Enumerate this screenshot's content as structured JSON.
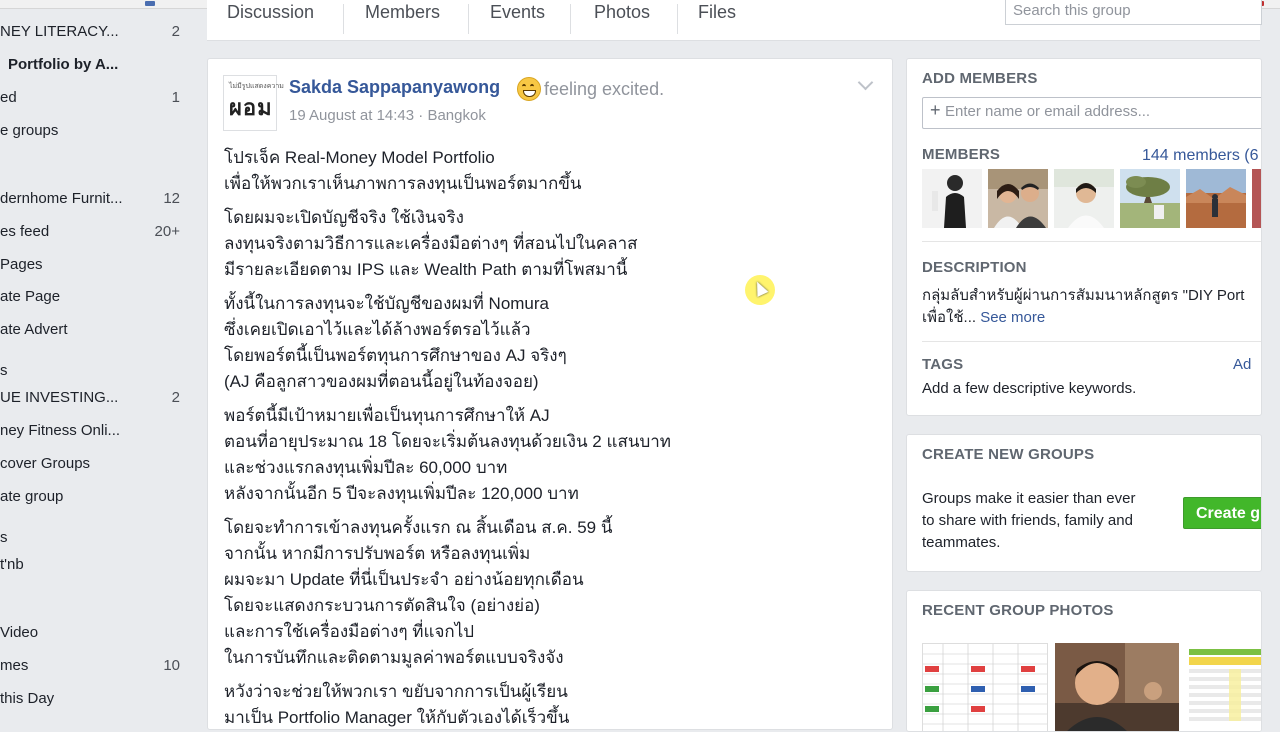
{
  "sidebar": {
    "items": [
      {
        "label": "NEY LITERACY...",
        "count": "2",
        "bold": false
      },
      {
        "label": "Portfolio by A...",
        "count": "",
        "bold": true
      },
      {
        "label": "ed",
        "count": "1",
        "bold": false
      },
      {
        "label": "e groups",
        "count": "",
        "bold": false
      },
      {
        "label": "dernhome Furnit...",
        "count": "12",
        "bold": false
      },
      {
        "label": "es feed",
        "count": "20+",
        "bold": false
      },
      {
        "label": "Pages",
        "count": "",
        "bold": false
      },
      {
        "label": "ate Page",
        "count": "",
        "bold": false
      },
      {
        "label": "ate Advert",
        "count": "",
        "bold": false
      },
      {
        "label": "s",
        "count": "",
        "bold": false
      },
      {
        "label": "UE INVESTING...",
        "count": "2",
        "bold": false
      },
      {
        "label": "ney Fitness Onli...",
        "count": "",
        "bold": false
      },
      {
        "label": "cover Groups",
        "count": "",
        "bold": false
      },
      {
        "label": "ate group",
        "count": "",
        "bold": false
      },
      {
        "label": "s",
        "count": "",
        "bold": false
      },
      {
        "label": "t'nb",
        "count": "",
        "bold": false
      },
      {
        "label": "Video",
        "count": "",
        "bold": false
      },
      {
        "label": "mes",
        "count": "10",
        "bold": false
      },
      {
        "label": "this Day",
        "count": "",
        "bold": false
      }
    ]
  },
  "tabs": {
    "discussion": "Discussion",
    "members": "Members",
    "events": "Events",
    "photos": "Photos",
    "files": "Files",
    "search_placeholder": "Search this group"
  },
  "post": {
    "avatar_small": "ไม่มีรูปแสดงความ",
    "avatar_main": "ผอม",
    "author": "Sakda Sappapanyawong",
    "feeling": "feeling excited.",
    "date": "19 August at 14:43",
    "location": "Bangkok",
    "meta_separator": "·",
    "paragraphs": [
      [
        "โปรเจ็ค Real-Money Model Portfolio",
        "เพื่อให้พวกเราเห็นภาพการลงทุนเป็นพอร์ตมากขึ้น"
      ],
      [
        "โดยผมจะเปิดบัญชีจริง ใช้เงินจริง",
        "ลงทุนจริงตามวิธีการและเครื่องมือต่างๆ ที่สอนไปในคลาส",
        "มีรายละเอียดตาม IPS และ Wealth Path ตามที่โพสมานี้"
      ],
      [
        "ทั้งนี้ในการลงทุนจะใช้บัญชีของผมที่ Nomura",
        "ซึ่งเคยเปิดเอาไว้และได้ล้างพอร์ตรอไว้แล้ว",
        "โดยพอร์ตนี้เป็นพอร์ตทุนการศึกษาของ AJ จริงๆ",
        "(AJ คือลูกสาวของผมที่ตอนนี้อยู่ในท้องจอย)"
      ],
      [
        "พอร์ตนี้มีเป้าหมายเพื่อเป็นทุนการศึกษาให้ AJ",
        "ตอนที่อายุประมาณ 18 โดยจะเริ่มต้นลงทุนด้วยเงิน 2 แสนบาท",
        "และช่วงแรกลงทุนเพิ่มปีละ 60,000 บาท",
        "หลังจากนั้นอีก 5 ปีจะลงทุนเพิ่มปีละ 120,000 บาท"
      ],
      [
        "โดยจะทำการเข้าลงทุนครั้งแรก ณ สิ้นเดือน ส.ค. 59 นี้",
        "จากนั้น หากมีการปรับพอร์ต หรือลงทุนเพิ่ม",
        "ผมจะมา Update ที่นี่เป็นประจำ อย่างน้อยทุกเดือน",
        "โดยจะแสดงกระบวนการตัดสินใจ (อย่างย่อ)",
        "และการใช้เครื่องมือต่างๆ ที่แจกไป",
        "ในการบันทึกและติดตามมูลค่าพอร์ตแบบจริงจัง"
      ],
      [
        "หวังว่าจะช่วยให้พวกเรา ขยับจากการเป็นผู้เรียน",
        "มาเป็น Portfolio Manager ให้กับตัวเองได้เร็วขึ้น"
      ]
    ]
  },
  "right": {
    "add_members": {
      "title": "ADD MEMBERS",
      "placeholder": "Enter name or email address..."
    },
    "members": {
      "title": "MEMBERS",
      "count_link": "144 members (6"
    },
    "description": {
      "title": "DESCRIPTION",
      "line1": "กลุ่มลับสำหรับผู้ผ่านการสัมมนาหลักสูตร \"DIY Port",
      "line2": "เพื่อใช้...",
      "see_more": "See more"
    },
    "tags": {
      "title": "TAGS",
      "add_link": "Ad",
      "text": "Add a few descriptive keywords."
    },
    "create_groups": {
      "title": "CREATE NEW GROUPS",
      "text1": "Groups make it easier than ever",
      "text2": "to share with friends, family and",
      "text3": "teammates.",
      "button": "Create g"
    },
    "recent_photos": {
      "title": "RECENT GROUP PHOTOS"
    }
  },
  "colors": {
    "link": "#365899",
    "background": "#e9ebee",
    "button_green": "#42b72a",
    "muted": "#90949c"
  }
}
